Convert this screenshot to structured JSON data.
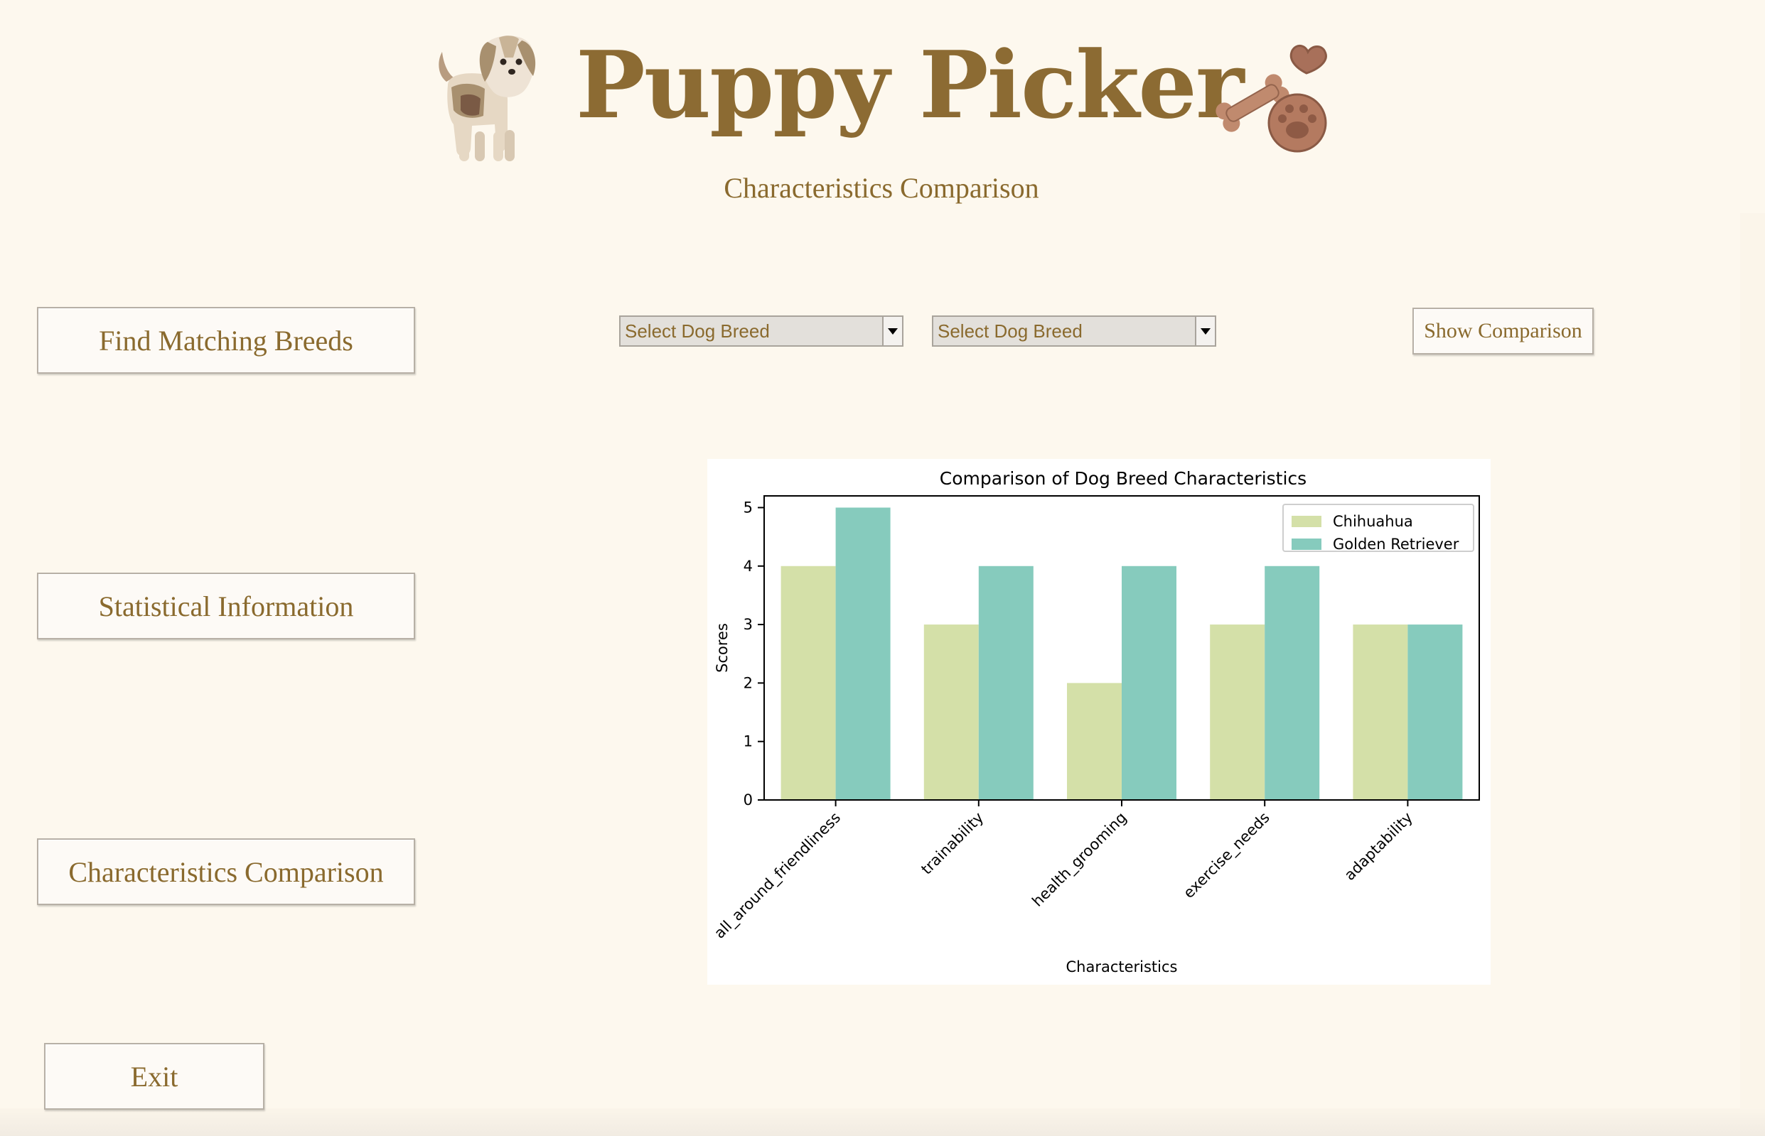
{
  "app": {
    "title": "Puppy Picker",
    "subtitle": "Characteristics Comparison",
    "logo_icon": "puppy-icon",
    "decor_icon": "bone-heart-paw-icon",
    "colors": {
      "background": "#fdf8ee",
      "title": "#8c6b33",
      "text": "#8a6a2e"
    }
  },
  "nav": {
    "find_label": "Find Matching Breeds",
    "stats_label": "Statistical Information",
    "char_label": "Characteristics Comparison",
    "exit_label": "Exit"
  },
  "comparison": {
    "select1_value": "Select Dog Breed",
    "select2_value": "Select Dog Breed",
    "show_label": "Show Comparison"
  },
  "chart_data": {
    "type": "bar",
    "title": "Comparison of Dog Breed Characteristics",
    "xlabel": "Characteristics",
    "ylabel": "Scores",
    "categories": [
      "all_around_friendliness",
      "trainability",
      "health_grooming",
      "exercise_needs",
      "adaptability"
    ],
    "series": [
      {
        "name": "Chihuahua",
        "values": [
          4,
          3,
          2,
          3,
          3
        ],
        "color": "#d4e0a8"
      },
      {
        "name": "Golden Retriever",
        "values": [
          5,
          4,
          4,
          4,
          3
        ],
        "color": "#86cbbd"
      }
    ],
    "yticks": [
      "0",
      "1",
      "2",
      "3",
      "4",
      "5"
    ],
    "ylim": [
      0,
      5.2
    ],
    "grid": false,
    "legend": "top-right"
  }
}
